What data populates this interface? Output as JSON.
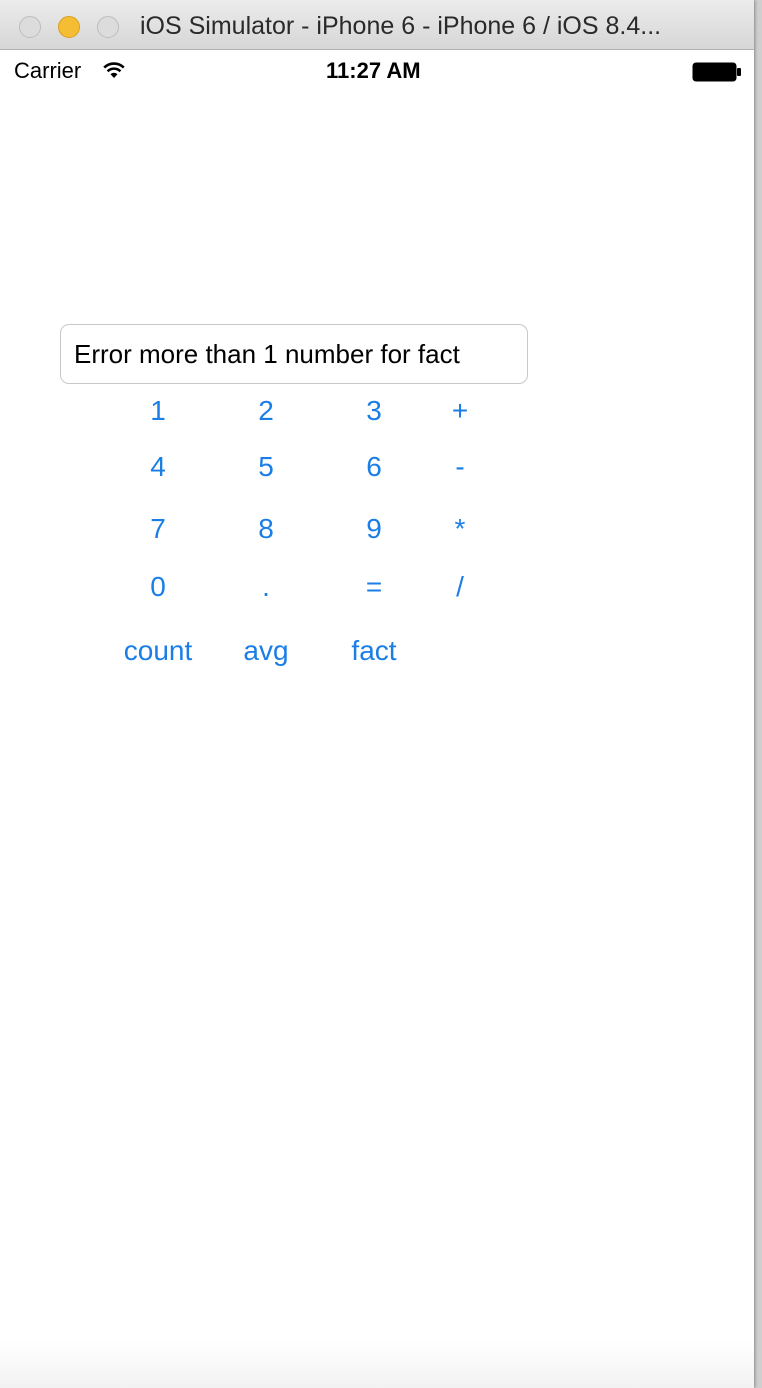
{
  "window": {
    "title": "iOS Simulator - iPhone 6 - iPhone 6 / iOS 8.4..."
  },
  "status_bar": {
    "carrier": "Carrier",
    "time": "11:27 AM"
  },
  "calculator": {
    "display_text": "Error more than 1 number for fact",
    "keys": {
      "k1": "1",
      "k2": "2",
      "k3": "3",
      "plus": "+",
      "k4": "4",
      "k5": "5",
      "k6": "6",
      "minus": "-",
      "k7": "7",
      "k8": "8",
      "k9": "9",
      "times": "*",
      "k0": "0",
      "dot": ".",
      "equals": "=",
      "divide": "/",
      "count": "count",
      "avg": "avg",
      "fact": "fact"
    }
  },
  "colors": {
    "accent": "#1a7ee6",
    "minimize": "#f5bd33"
  }
}
